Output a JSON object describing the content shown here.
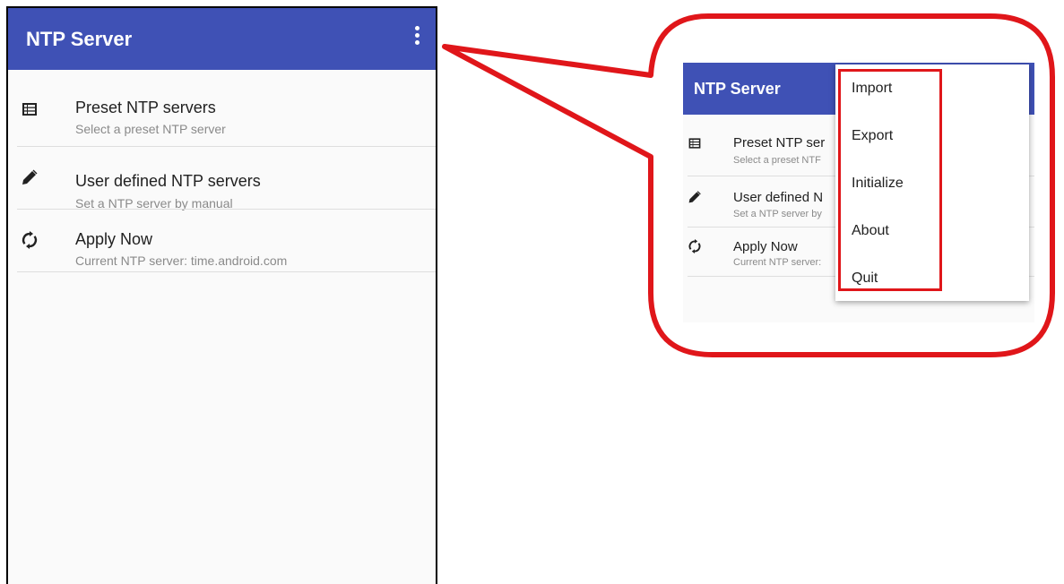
{
  "app": {
    "title": "NTP Server"
  },
  "list": [
    {
      "icon": "list-icon",
      "label": "Preset NTP servers",
      "sub": "Select a preset NTP server"
    },
    {
      "icon": "pencil-icon",
      "label": "User defined NTP servers",
      "sub": "Set a NTP server by manual"
    },
    {
      "icon": "sync-icon",
      "label": "Apply Now",
      "sub": "Current NTP server: time.android.com"
    }
  ],
  "zoom": {
    "title": "NTP Server",
    "list": [
      {
        "label": "Preset NTP ser",
        "sub": "Select a preset NTF"
      },
      {
        "label": "User defined N",
        "sub": "Set a NTP server by"
      },
      {
        "label": "Apply Now",
        "sub": "Current NTP server:"
      }
    ]
  },
  "menu": {
    "items": [
      "Import",
      "Export",
      "Initialize",
      "About",
      "Quit"
    ]
  },
  "colors": {
    "appbar": "#3f51b5",
    "highlight": "#e0161a"
  }
}
